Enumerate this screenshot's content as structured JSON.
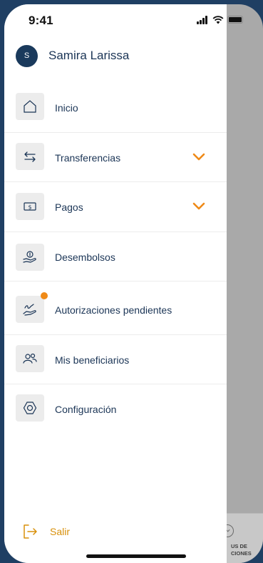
{
  "status_bar": {
    "time": "9:41"
  },
  "user": {
    "initial": "S",
    "name": "Samira Larissa"
  },
  "menu": {
    "items": [
      {
        "label": "Inicio",
        "icon": "home-icon",
        "expandable": false,
        "badge": false
      },
      {
        "label": "Transferencias",
        "icon": "transfer-arrows-icon",
        "expandable": true,
        "badge": false
      },
      {
        "label": "Pagos",
        "icon": "money-bill-icon",
        "expandable": true,
        "badge": false
      },
      {
        "label": "Desembolsos",
        "icon": "hand-coin-icon",
        "expandable": false,
        "badge": false
      },
      {
        "label": "Autorizaciones pendientes",
        "icon": "signature-hand-icon",
        "expandable": false,
        "badge": true
      },
      {
        "label": "Mis beneficiarios",
        "icon": "users-icon",
        "expandable": false,
        "badge": false
      },
      {
        "label": "Configuración",
        "icon": "hexagon-settings-icon",
        "expandable": false,
        "badge": false
      }
    ]
  },
  "logout": {
    "label": "Salir",
    "icon": "logout-icon"
  },
  "background_tab": {
    "label": "US DE CIONES"
  },
  "colors": {
    "brand_navy": "#1b3556",
    "accent_orange": "#ef8a17",
    "logout_gold": "#d8900a",
    "icon_tile": "#ececec",
    "overlay": "#a9a9a9"
  }
}
